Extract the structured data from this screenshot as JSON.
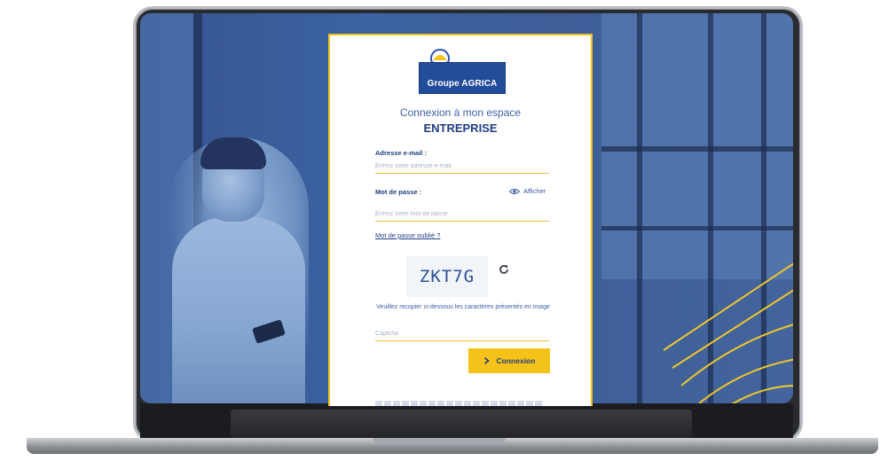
{
  "logo": {
    "text": "Groupe AGRICA"
  },
  "card": {
    "subtitle": "Connexion à mon espace",
    "title": "ENTREPRISE"
  },
  "email": {
    "label": "Adresse e-mail :",
    "placeholder": "Entrez votre adresse e-mail"
  },
  "password": {
    "label": "Mot de passe :",
    "placeholder": "Entrez votre mot de passe",
    "show_label": "Afficher",
    "forgot_label": "Mot de passe oublié ?"
  },
  "captcha": {
    "code": "ZKT7G",
    "help": "Veuillez recopier ci-dessous les caractères présentés en image",
    "placeholder": "Captcha"
  },
  "submit": {
    "label": "Connexion"
  },
  "icons": {
    "logo": "agrica-logo-icon",
    "show_password": "eye-icon",
    "refresh": "refresh-icon",
    "submit": "chevron-right-icon"
  },
  "colors": {
    "brand_blue": "#1f3d82",
    "accent_yellow": "#f5c219",
    "screen_blue": "#3c63a3"
  }
}
